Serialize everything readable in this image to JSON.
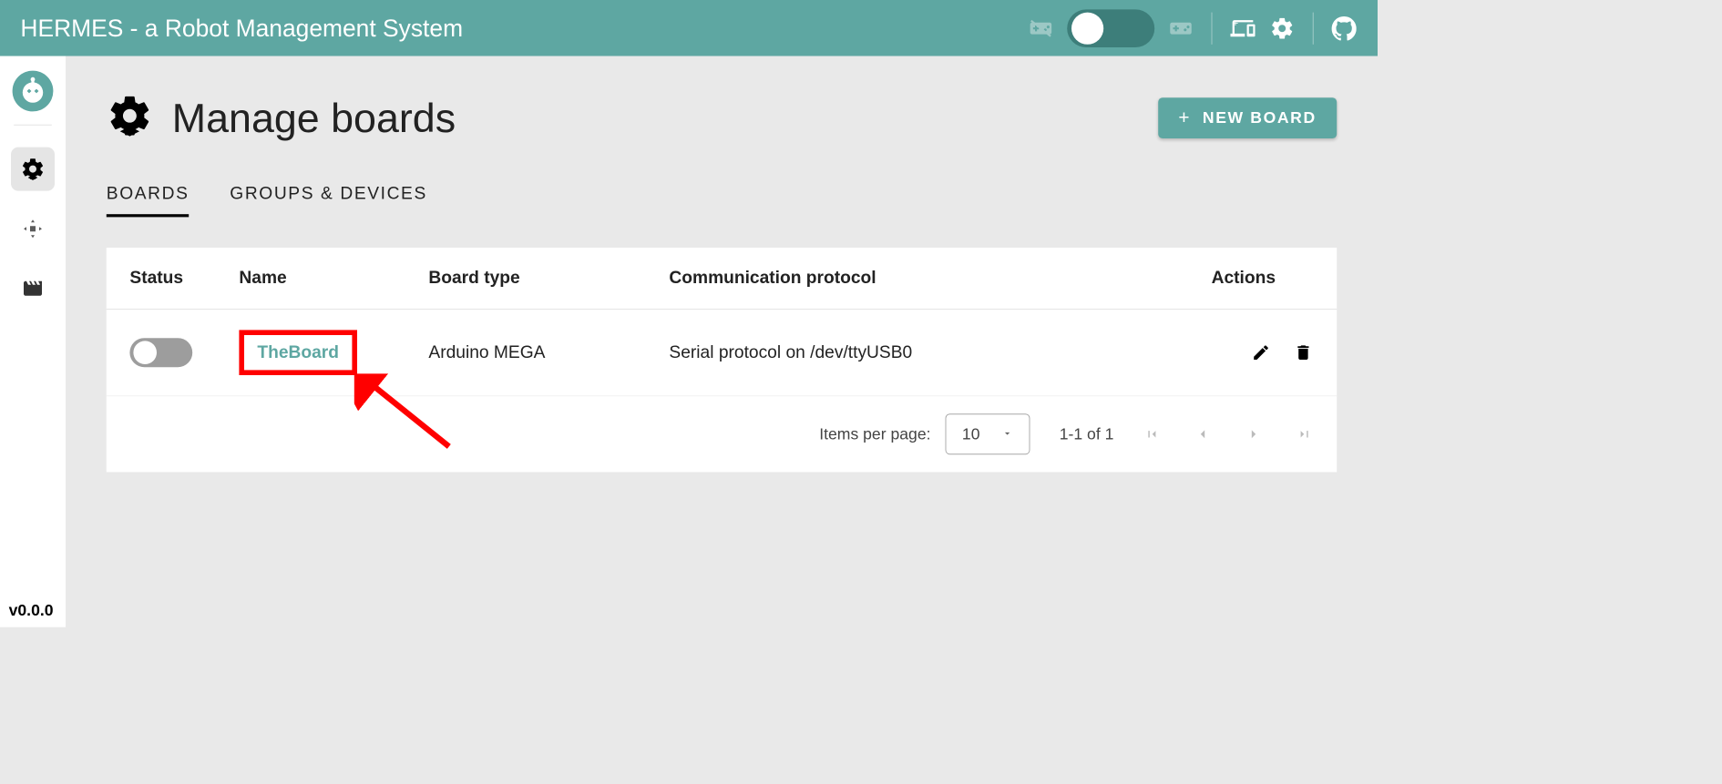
{
  "appbar": {
    "title": "HERMES - a Robot Management System"
  },
  "sidebar": {
    "version": "v0.0.0"
  },
  "page": {
    "title": "Manage boards",
    "new_board_button": "NEW BOARD"
  },
  "tabs": [
    {
      "label": "BOARDS",
      "active": true
    },
    {
      "label": "GROUPS & DEVICES",
      "active": false
    }
  ],
  "table": {
    "headers": {
      "status": "Status",
      "name": "Name",
      "board_type": "Board type",
      "protocol": "Communication protocol",
      "actions": "Actions"
    },
    "rows": [
      {
        "status_on": false,
        "name": "TheBoard",
        "board_type": "Arduino MEGA",
        "protocol": "Serial protocol on /dev/ttyUSB0"
      }
    ],
    "footer": {
      "items_per_page_label": "Items per page:",
      "items_per_page_value": "10",
      "range": "1-1 of 1"
    }
  },
  "colors": {
    "accent": "#5ea7a2",
    "highlight": "#ff0000"
  }
}
